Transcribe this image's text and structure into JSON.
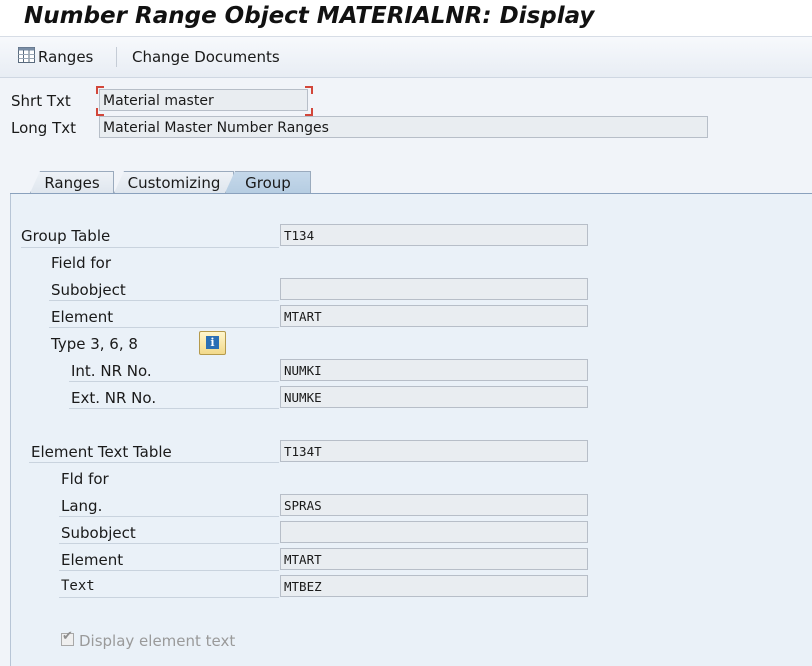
{
  "window": {
    "title": "Number Range Object MATERIALNR: Display"
  },
  "toolbar": {
    "ranges": "Ranges",
    "change_documents": "Change Documents"
  },
  "header": {
    "short_text_label": "Shrt Txt",
    "short_text_value": "Material master",
    "long_text_label": "Long Txt",
    "long_text_value": "Material Master Number Ranges"
  },
  "tabs": [
    {
      "label": "Ranges",
      "active": false
    },
    {
      "label": "Customizing",
      "active": false
    },
    {
      "label": "Group",
      "active": true
    }
  ],
  "group": {
    "group_table_label": "Group Table",
    "group_table_value": "T134",
    "field_for_label": "Field for",
    "subobject_label": "Subobject",
    "subobject_value": "",
    "element_label": "Element",
    "element_value": "MTART",
    "type_label": "Type 3, 6, 8",
    "int_nr_label": "Int. NR No.",
    "int_nr_value": "NUMKI",
    "ext_nr_label": "Ext. NR No.",
    "ext_nr_value": "NUMKE",
    "element_text_table_label": "Element Text Table",
    "element_text_table_value": "T134T",
    "fld_for_label": "Fld for",
    "lang_label": "Lang.",
    "lang_value": "SPRAS",
    "t_subobject_label": "Subobject",
    "t_subobject_value": "",
    "t_element_label": "Element",
    "t_element_value": "MTART",
    "text_label": "Text",
    "text_value": "MTBEZ",
    "display_element_text_label": "Display element text",
    "display_element_text_checked": true
  }
}
